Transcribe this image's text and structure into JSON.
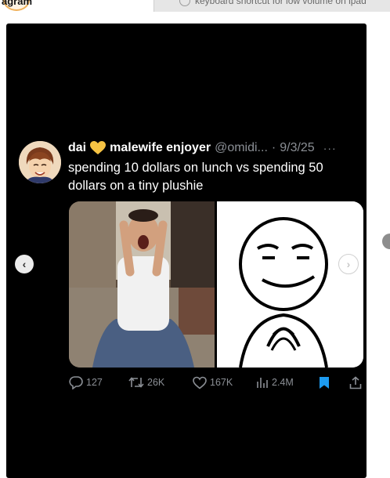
{
  "browser": {
    "active_tab": "agram",
    "inactive_tab": "keyboard shortcut for low volume on ipad"
  },
  "tweet": {
    "display_name": "dai",
    "handle_text": "malewife enjoyer",
    "handle": "@omidi...",
    "separator": "·",
    "date": "9/3/25",
    "more": "···",
    "text": "spending 10 dollars on lunch vs spending 50 dollars on a tiny plushie"
  },
  "actions": {
    "replies": "127",
    "retweets": "26K",
    "likes": "167K",
    "views": "2.4M"
  },
  "nav": {
    "prev": "‹",
    "next": "›"
  },
  "colors": {
    "bookmark": "#1d9bf0",
    "heart": "#f6c343",
    "icon_gray": "#8b8f95"
  }
}
